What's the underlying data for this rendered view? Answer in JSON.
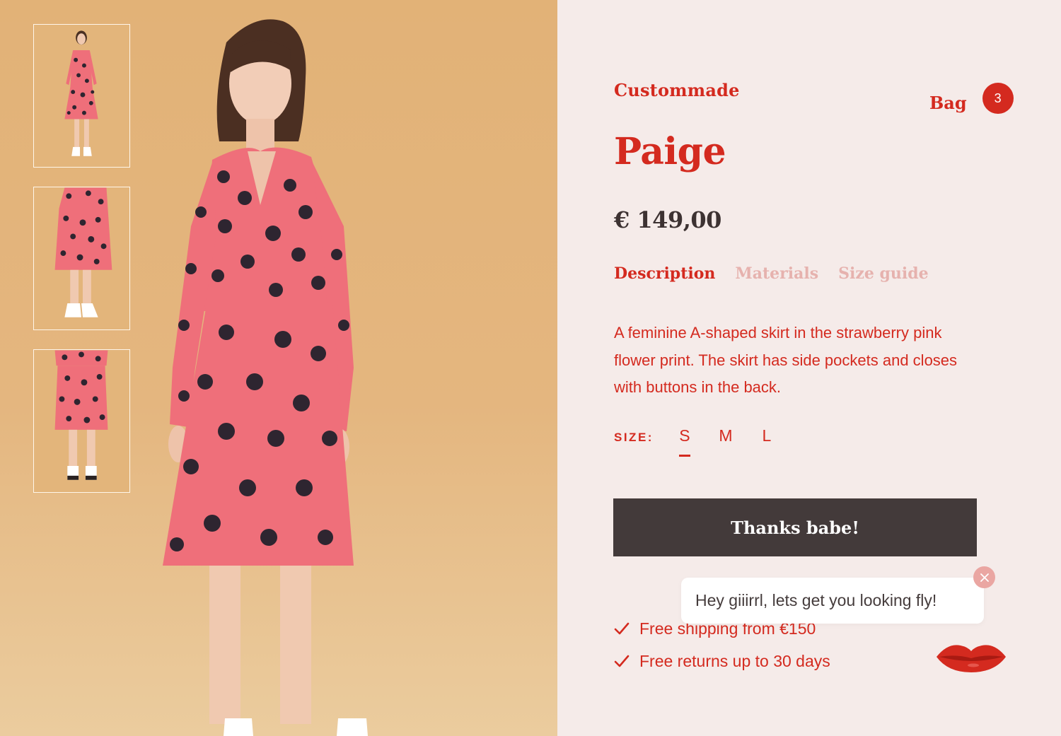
{
  "gallery": {
    "thumbnails": [
      "product-thumbnail-front",
      "product-thumbnail-skirt-side",
      "product-thumbnail-skirt-back"
    ],
    "main_image": "model-in-pink-floral-dress"
  },
  "header": {
    "brand": "Custommade",
    "bag_label": "Bag",
    "bag_count": "3"
  },
  "product": {
    "title": "Paige",
    "price": "€ 149,00",
    "tabs": [
      {
        "label": "Description",
        "active": true
      },
      {
        "label": "Materials",
        "active": false
      },
      {
        "label": "Size guide",
        "active": false
      }
    ],
    "description": "A feminine A-shaped skirt in the strawberry pink flower print. The skirt has side pockets and closes with buttons in the back.",
    "size_label": "SIZE:",
    "sizes": [
      "S",
      "M",
      "L"
    ],
    "selected_size": "S",
    "cta_label": "Thanks babe!",
    "perks": [
      "Free shipping from €150",
      "Free returns up to 30 days"
    ]
  },
  "chat": {
    "message": "Hey giiirrl, lets get you looking fly!",
    "close_icon": "close-icon",
    "launcher_icon": "lips-icon"
  },
  "colors": {
    "accent": "#d42a1f",
    "panel_bg": "#f5ebe9",
    "photo_bg": "#e2b277",
    "button_bg": "#433a3a",
    "tab_inactive": "#e6b2ae"
  }
}
